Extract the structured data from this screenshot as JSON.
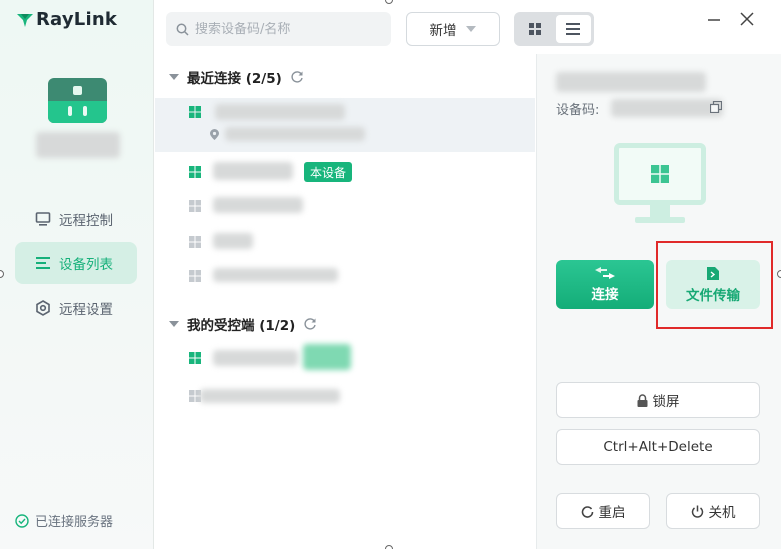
{
  "app": {
    "logo_text": "RayLink"
  },
  "sidebar": {
    "items": [
      {
        "label": "远程控制",
        "icon": "monitor-icon"
      },
      {
        "label": "设备列表",
        "icon": "list-icon",
        "active": true
      },
      {
        "label": "远程设置",
        "icon": "settings-icon"
      }
    ],
    "status_text": "已连接服务器"
  },
  "toolbar": {
    "search_placeholder": "搜索设备码/名称",
    "add_label": "新增"
  },
  "device_list": {
    "recent_title": "最近连接 (2/5)",
    "controlled_title": "我的受控端 (1/2)",
    "this_device_tag": "本设备"
  },
  "detail": {
    "device_code_label": "设备码:",
    "connect_label": "连接",
    "file_transfer_label": "文件传输",
    "lock_label": "锁屏",
    "cad_label": "Ctrl+Alt+Delete",
    "restart_label": "重启",
    "shutdown_label": "关机"
  },
  "colors": {
    "accent": "#18b57c",
    "highlight": "#e02a2a"
  }
}
